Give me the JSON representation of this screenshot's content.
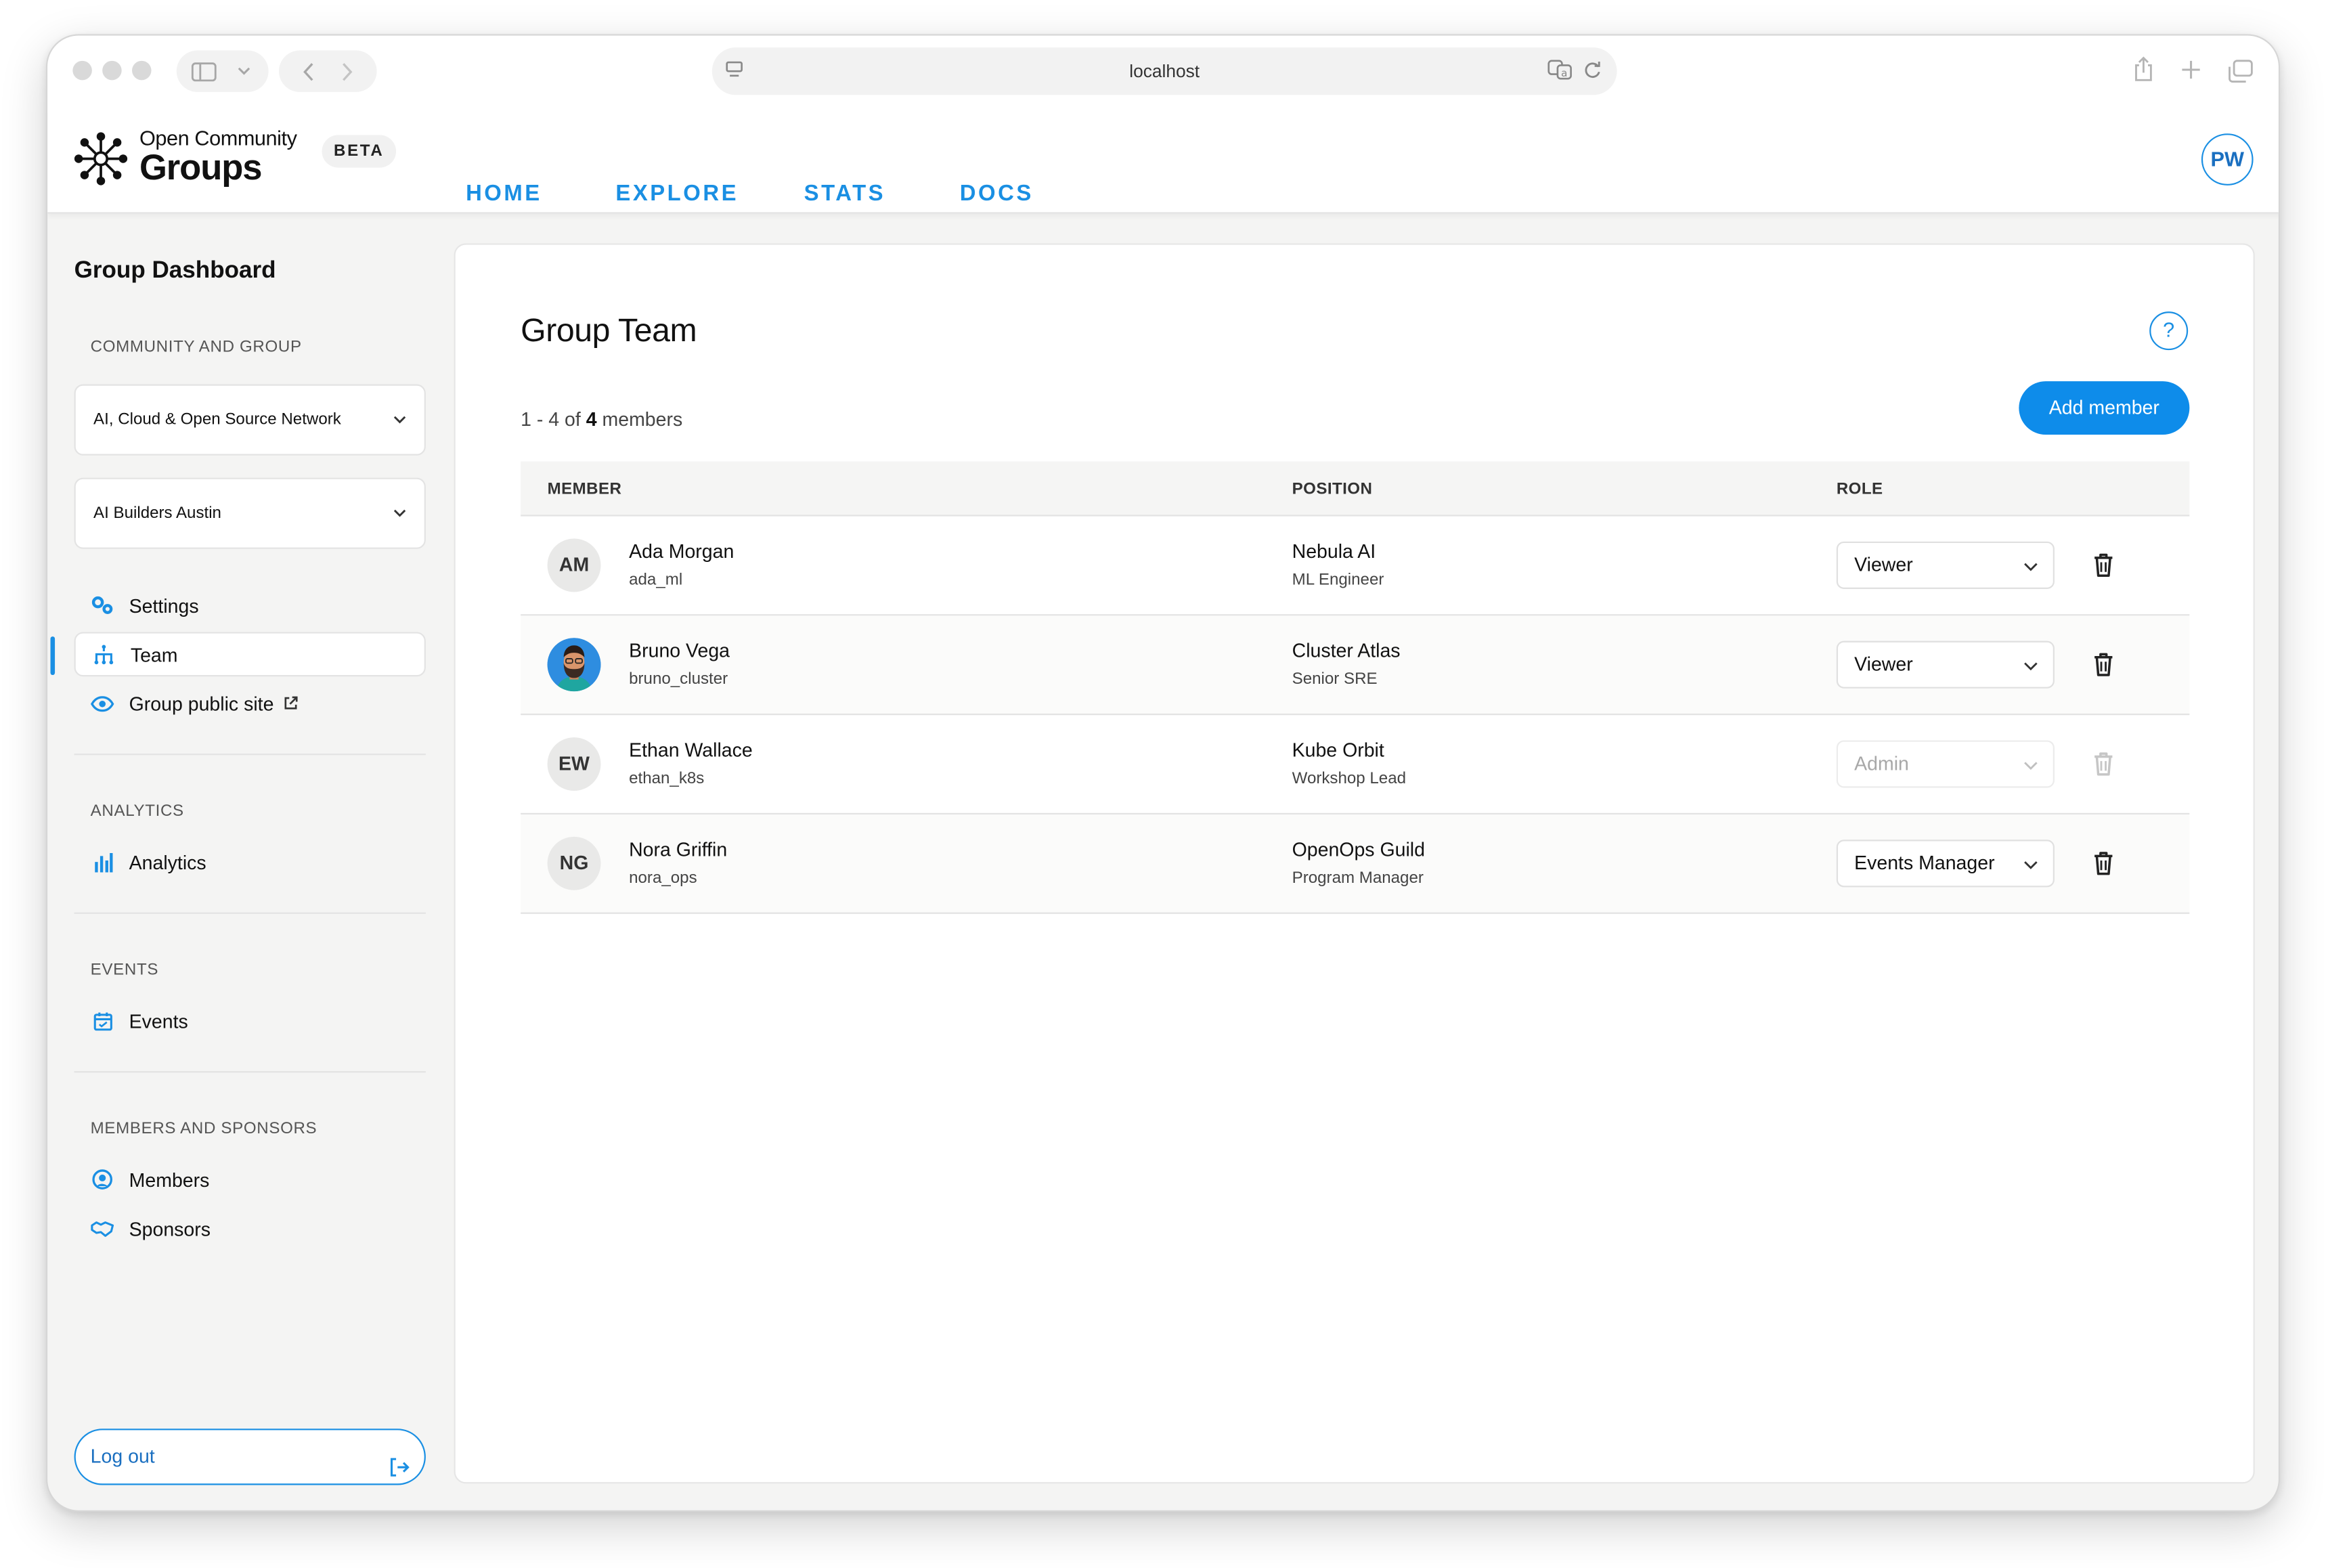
{
  "browser": {
    "url": "localhost"
  },
  "header": {
    "logo_line1": "Open Community",
    "logo_line2": "Groups",
    "badge": "BETA",
    "nav": [
      "HOME",
      "EXPLORE",
      "STATS",
      "DOCS"
    ],
    "user_initials": "PW"
  },
  "sidebar": {
    "title": "Group Dashboard",
    "section_community": "COMMUNITY AND GROUP",
    "community_select": "AI, Cloud & Open Source Network",
    "group_select": "AI Builders Austin",
    "items_group": [
      {
        "label": "Settings",
        "icon": "gears-icon"
      },
      {
        "label": "Team",
        "icon": "org-chart-icon"
      },
      {
        "label": "Group public site",
        "icon": "eye-icon"
      }
    ],
    "section_analytics": "ANALYTICS",
    "analytics_item": "Analytics",
    "section_events": "EVENTS",
    "events_item": "Events",
    "section_members": "MEMBERS AND SPONSORS",
    "members_item": "Members",
    "sponsors_item": "Sponsors",
    "logout": "Log out",
    "active_item": "Team"
  },
  "main": {
    "title": "Group Team",
    "help": "?",
    "count_prefix": "1 - 4 of ",
    "count_total": "4",
    "count_suffix": " members",
    "add_button": "Add member",
    "columns": [
      "MEMBER",
      "POSITION",
      "ROLE"
    ],
    "members": [
      {
        "initials": "AM",
        "name": "Ada Morgan",
        "username": "ada_ml",
        "company": "Nebula AI",
        "title": "ML Engineer",
        "role": "Viewer",
        "editable": true
      },
      {
        "initials": "",
        "name": "Bruno Vega",
        "username": "bruno_cluster",
        "company": "Cluster Atlas",
        "title": "Senior SRE",
        "role": "Viewer",
        "editable": true
      },
      {
        "initials": "EW",
        "name": "Ethan Wallace",
        "username": "ethan_k8s",
        "company": "Kube Orbit",
        "title": "Workshop Lead",
        "role": "Admin",
        "editable": false
      },
      {
        "initials": "NG",
        "name": "Nora Griffin",
        "username": "nora_ops",
        "company": "OpenOps Guild",
        "title": "Program Manager",
        "role": "Events Manager",
        "editable": true
      }
    ]
  },
  "colors": {
    "accent": "#1a8fe3",
    "primary_button": "#0e8cea",
    "sidebar_bg": "#f4f4f3"
  }
}
